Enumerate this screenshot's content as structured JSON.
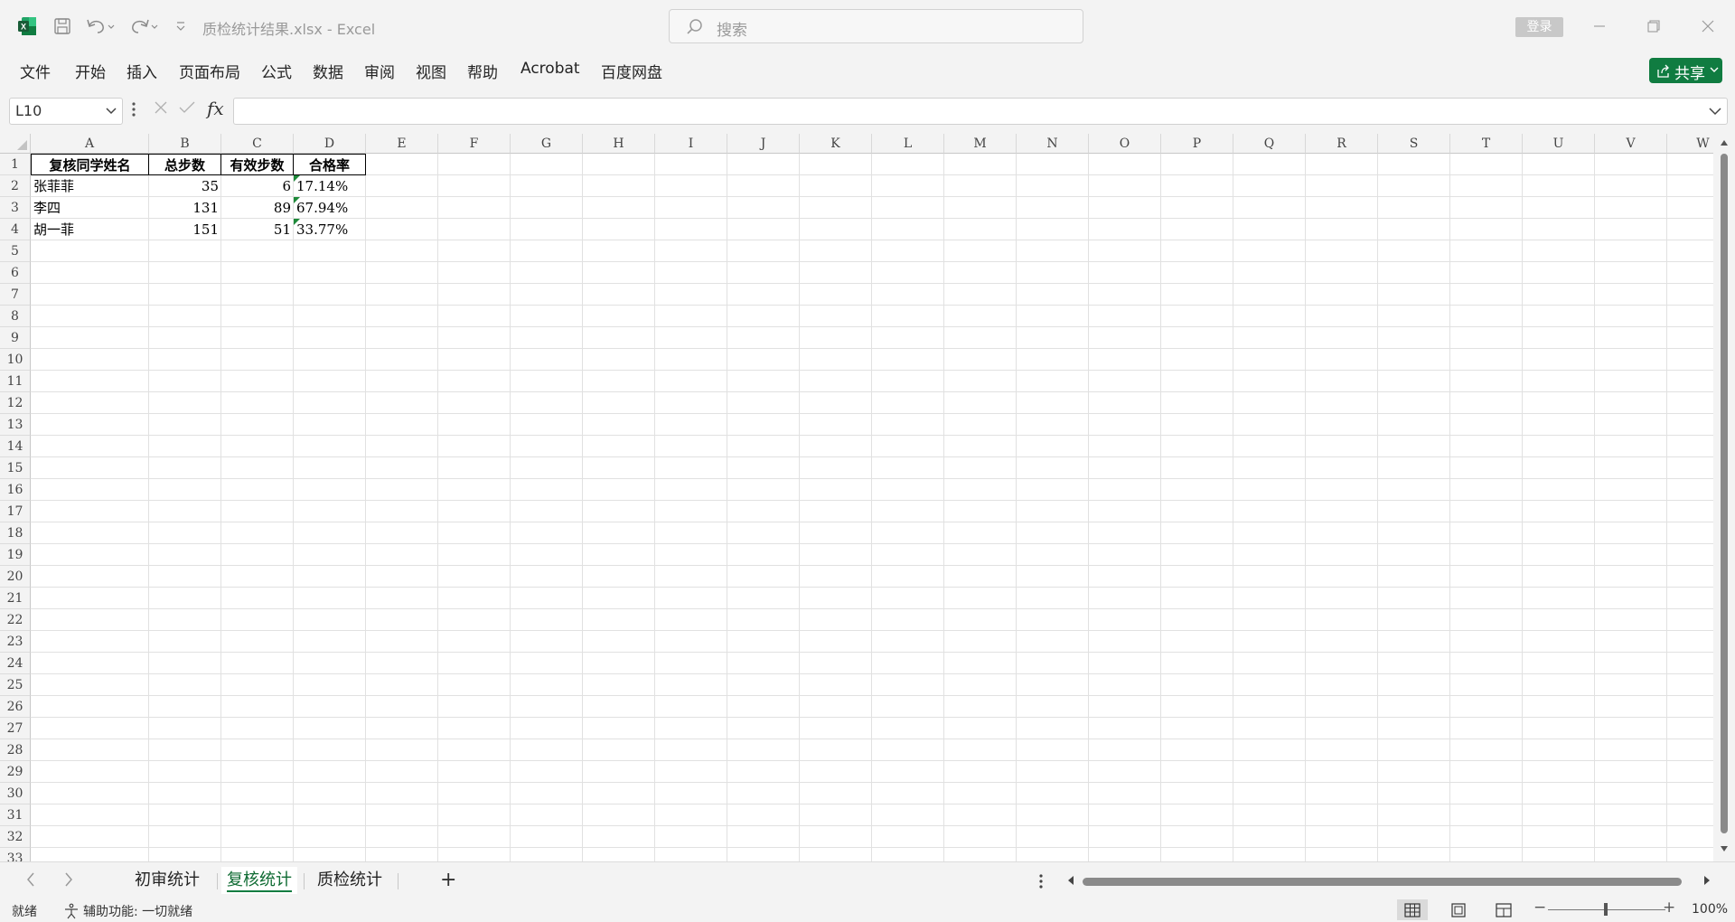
{
  "window": {
    "doc_title": "质检统计结果.xlsx  -  Excel",
    "search_placeholder": "搜索",
    "login_label": "登录"
  },
  "menu": {
    "items": [
      "文件",
      "开始",
      "插入",
      "页面布局",
      "公式",
      "数据",
      "审阅",
      "视图",
      "帮助",
      "Acrobat",
      "百度网盘"
    ],
    "share_label": "共享"
  },
  "formula_bar": {
    "name_box": "L10",
    "formula": ""
  },
  "grid": {
    "columns": [
      "A",
      "B",
      "C",
      "D",
      "E",
      "F",
      "G",
      "H",
      "I",
      "J",
      "K",
      "L",
      "M",
      "N",
      "O",
      "P",
      "Q",
      "R",
      "S",
      "T",
      "U",
      "V",
      "W"
    ],
    "rows": [
      "1",
      "2",
      "3",
      "4",
      "5",
      "6",
      "7",
      "8",
      "9",
      "10",
      "11",
      "12",
      "13",
      "14",
      "15",
      "16",
      "17",
      "18",
      "19",
      "20",
      "21",
      "22",
      "23",
      "24",
      "25",
      "26",
      "27",
      "28",
      "29",
      "30",
      "31",
      "32",
      "33"
    ],
    "table": {
      "headers": [
        "复核同学姓名",
        "总步数",
        "有效步数",
        "合格率"
      ],
      "rows": [
        [
          "张菲菲",
          "35",
          "6",
          "17.14%"
        ],
        [
          "李四",
          "131",
          "89",
          "67.94%"
        ],
        [
          "胡一菲",
          "151",
          "51",
          "33.77%"
        ]
      ]
    }
  },
  "sheets": {
    "tabs": [
      "初审统计",
      "复核统计",
      "质检统计"
    ],
    "active": "复核统计"
  },
  "status": {
    "ready": "就绪",
    "accessibility": "辅助功能: 一切就绪",
    "zoom": "100%",
    "zoom_minus": "−",
    "zoom_plus": "+"
  },
  "colors": {
    "accent": "#107c41"
  }
}
